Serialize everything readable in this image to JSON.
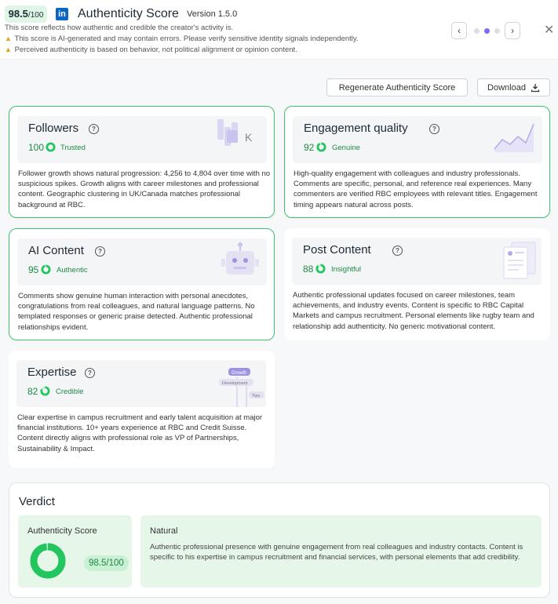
{
  "header": {
    "score_big": "98.5",
    "score_small": "/100",
    "logo_letter": "in",
    "title": "Authenticity Score",
    "version": "Version 1.5.0",
    "subtitle": "This score reflects how authentic and credible the creator's activity is.",
    "warning_1": "This score is AI-generated and may contain errors. Please verify sensitive identity signals independently.",
    "warning_2": "Perceived authenticity is based on behavior, not political alignment or opinion content.",
    "prev_icon": "‹",
    "next_icon": "›",
    "close_icon": "✕",
    "carousel_active_index": 1
  },
  "actions": {
    "regenerate_label": "Regenerate Authenticity Score",
    "download_label": "Download"
  },
  "cards": {
    "followers": {
      "title": "Followers",
      "score": "100",
      "label": "Trusted",
      "score_fraction": 1.0,
      "description": "Follower growth shows natural progression: 4,256 to 4,804 over time with no suspicious spikes. Growth aligns with career milestones and professional content. Geographic clustering in UK/Canada matches professional background at RBC.",
      "illustration_text": "K"
    },
    "engagement": {
      "title": "Engagement quality",
      "score": "92",
      "label": "Genuine",
      "score_fraction": 0.92,
      "description": "High-quality engagement with colleagues and industry professionals. Comments are specific, personal, and reference real experiences. Many commenters are verified RBC employees with relevant titles. Engagement timing appears natural across posts."
    },
    "ai_content": {
      "title": "AI Content",
      "score": "95",
      "label": "Authentic",
      "score_fraction": 0.95,
      "description": "Comments show genuine human interaction with personal anecdotes, congratulations from real colleagues, and natural language patterns. No templated responses or generic praise detected. Authentic professional relationships evident."
    },
    "post_content": {
      "title": "Post Content",
      "score": "88",
      "label": "Insightful",
      "score_fraction": 0.88,
      "description": "Authentic professional updates focused on career milestones, team achievements, and industry events. Content is specific to RBC Capital Markets and campus recruitment. Personal elements like rugby team and relationship add authenticity. No generic motivational content."
    },
    "expertise": {
      "title": "Expertise",
      "score": "82",
      "label": "Credible",
      "score_fraction": 0.82,
      "description": "Clear expertise in campus recruitment and early talent acquisition at major financial institutions. 10+ years experience at RBC and Credit Suisse. Content directly aligns with professional role as VP of Partnerships, Sustainability & Impact.",
      "tags": [
        "Growth",
        "Development",
        "Tips"
      ]
    }
  },
  "verdict": {
    "title": "Verdict",
    "score_label": "Authenticity Score",
    "score_value": "98.5/100",
    "score_fraction": 0.985,
    "category": "Natural",
    "description": "Authentic professional presence with genuine engagement from real colleagues and industry contacts. Content is specific to his expertise in campus recruitment and financial services, with personal elements that add credibility."
  },
  "colors": {
    "accent_green": "#22c55e",
    "text_green": "#1e8a44",
    "linkedin_blue": "#0a66c2",
    "carousel_active": "#7c6cf0"
  }
}
